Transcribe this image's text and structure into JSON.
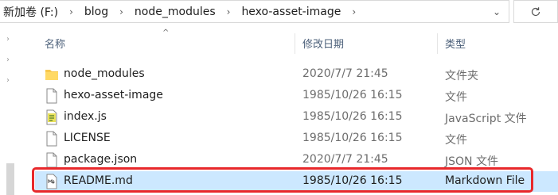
{
  "address": {
    "drive": "新加卷 (F:)",
    "crumbs": [
      "blog",
      "node_modules",
      "hexo-asset-image"
    ]
  },
  "columns": {
    "name": "名称",
    "date": "修改日期",
    "type": "类型"
  },
  "files": [
    {
      "name": "node_modules",
      "date": "2020/7/7 21:45",
      "type": "文件夹",
      "icon": "folder-icon"
    },
    {
      "name": "hexo-asset-image",
      "date": "1985/10/26 16:15",
      "type": "文件",
      "icon": "file-icon"
    },
    {
      "name": "index.js",
      "date": "1985/10/26 16:15",
      "type": "JavaScript 文件",
      "icon": "js-file-icon"
    },
    {
      "name": "LICENSE",
      "date": "1985/10/26 16:15",
      "type": "文件",
      "icon": "file-icon"
    },
    {
      "name": "package.json",
      "date": "2020/7/7 21:45",
      "type": "JSON 文件",
      "icon": "json-file-icon"
    },
    {
      "name": "README.md",
      "date": "1985/10/26 16:15",
      "type": "Markdown File",
      "icon": "markdown-file-icon"
    }
  ],
  "colors": {
    "selected_row": "#cce8ff",
    "highlight_border": "#e8282b",
    "header_text": "#4c607a"
  }
}
